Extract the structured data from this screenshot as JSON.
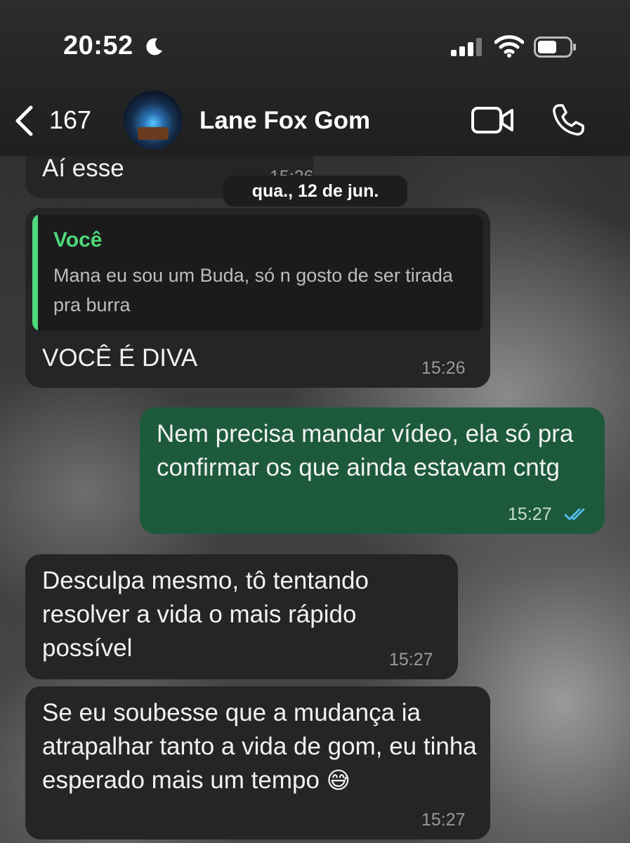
{
  "status_bar": {
    "time": "20:52"
  },
  "header": {
    "back_count": "167",
    "contact_name": "Lane Fox Gom"
  },
  "date_separator": "qua., 12 de jun.",
  "messages": [
    {
      "direction": "incoming",
      "text": "Aí esse",
      "time": "15:26"
    },
    {
      "direction": "incoming",
      "quote": {
        "author": "Você",
        "text": "Mana eu sou um Buda, só n gosto de ser tirada pra burra"
      },
      "text": "VOCÊ É DIVA",
      "time": "15:26"
    },
    {
      "direction": "outgoing",
      "text": "Nem precisa mandar vídeo, ela só pra confirmar os que ainda estavam cntg",
      "time": "15:27",
      "status": "read"
    },
    {
      "direction": "incoming",
      "text": "Desculpa mesmo, tô tentando resolver a vida o mais rápido possível",
      "time": "15:27"
    },
    {
      "direction": "incoming",
      "text": "Se eu soubesse que a mudança ia atrapalhar tanto a vida de gom, eu tinha esperado mais um tempo",
      "emoji": "😅",
      "time": "15:27"
    }
  ],
  "icons": {
    "moon": "moon-icon",
    "signal": "cellular-signal-icon",
    "wifi": "wifi-icon",
    "battery": "battery-icon",
    "back": "chevron-left-icon",
    "video": "video-call-icon",
    "phone": "phone-call-icon",
    "read_receipt": "double-check-icon"
  },
  "colors": {
    "incoming_bubble": "#242526",
    "outgoing_bubble": "#1d5a3c",
    "quote_accent": "#4fd97b",
    "read_tick": "#53bdeb"
  }
}
